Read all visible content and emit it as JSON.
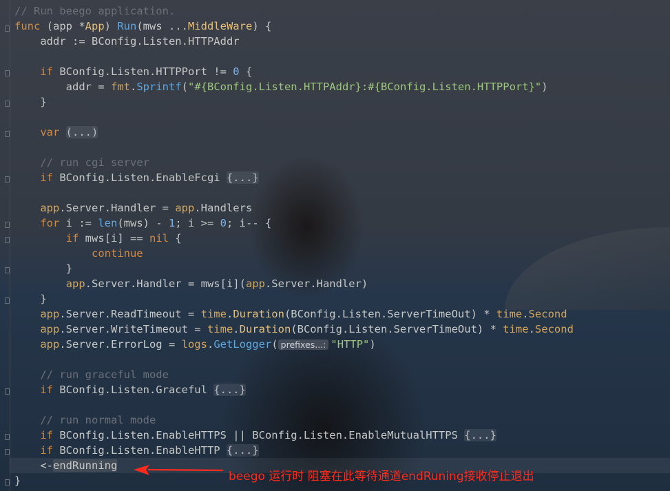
{
  "colors": {
    "annotation": "#ff2b1d",
    "keyword": "#d08b45",
    "function": "#5fa7e0",
    "comment": "#6b7079"
  },
  "icons": [
    "fold-marker-icon",
    "red-arrow-icon"
  ],
  "code": {
    "l0": "// Run beego application.",
    "l1a": "func",
    "l1b": " (app *",
    "l1c": "App",
    "l1d": ") ",
    "l1e": "Run",
    "l1f": "(mws ...",
    "l1g": "MiddleWare",
    "l1h": ") {",
    "l2": "    addr := BConfig.Listen.HTTPAddr",
    "l4a": "    ",
    "l4b": "if",
    "l4c": " BConfig.Listen.HTTPPort != ",
    "l4d": "0",
    "l4e": " {",
    "l5a": "        addr = ",
    "l5b": "fmt",
    "l5c": ".",
    "l5d": "Sprintf",
    "l5e": "(",
    "l5f": "\"#{BConfig.Listen.HTTPAddr}:#{BConfig.Listen.HTTPPort}\"",
    "l5g": ")",
    "l6": "    }",
    "l8a": "    ",
    "l8b": "var",
    "l8c": " ",
    "l8d": "(...)",
    "l10": "    // run cgi server",
    "l11a": "    ",
    "l11b": "if",
    "l11c": " BConfig.Listen.EnableFcgi ",
    "l11d": "{...}",
    "l13a": "    ",
    "l13b": "app",
    "l13c": ".Server.Handler = ",
    "l13d": "app",
    "l13e": ".Handlers",
    "l14a": "    ",
    "l14b": "for",
    "l14c": " i := ",
    "l14d": "len",
    "l14e": "(mws) - ",
    "l14f": "1",
    "l14g": "; i >= ",
    "l14h": "0",
    "l14i": "; i-- {",
    "l15a": "        ",
    "l15b": "if",
    "l15c": " mws[i] == ",
    "l15d": "nil",
    "l15e": " {",
    "l16a": "            ",
    "l16b": "continue",
    "l17": "        }",
    "l18a": "        ",
    "l18b": "app",
    "l18c": ".Server.Handler = mws[i](",
    "l18d": "app",
    "l18e": ".Server.Handler)",
    "l19": "    }",
    "l20a": "    ",
    "l20b": "app",
    "l20c": ".Server.ReadTimeout = ",
    "l20d": "time",
    "l20e": ".",
    "l20f": "Duration",
    "l20g": "(BConfig.Listen.ServerTimeOut) * ",
    "l20h": "time",
    "l20i": ".",
    "l20j": "Second",
    "l21a": "    ",
    "l21b": "app",
    "l21c": ".Server.WriteTimeout = ",
    "l21d": "time",
    "l21e": ".",
    "l21f": "Duration",
    "l21g": "(BConfig.Listen.ServerTimeOut) * ",
    "l21h": "time",
    "l21i": ".",
    "l21j": "Second",
    "l22a": "    ",
    "l22b": "app",
    "l22c": ".Server.ErrorLog = ",
    "l22d": "logs",
    "l22e": ".",
    "l22f": "GetLogger",
    "l22g": "(",
    "l22hint": "prefixes...:",
    "l22h": "\"HTTP\"",
    "l22i": ")",
    "l24": "    // run graceful mode",
    "l25a": "    ",
    "l25b": "if",
    "l25c": " BConfig.Listen.Graceful ",
    "l25d": "{...}",
    "l27": "    // run normal mode",
    "l28a": "    ",
    "l28b": "if",
    "l28c": " BConfig.Listen.EnableHTTPS || BConfig.Listen.EnableMutualHTTPS ",
    "l28d": "{...}",
    "l29a": "    ",
    "l29b": "if",
    "l29c": " BConfig.Listen.EnableHTTP ",
    "l29d": "{...}",
    "l30a": "    <-",
    "l30b": "endRunning",
    "l31": "}"
  },
  "annotation": "beego 运行时 阻塞在此等待通道endRuning接收停止退出"
}
